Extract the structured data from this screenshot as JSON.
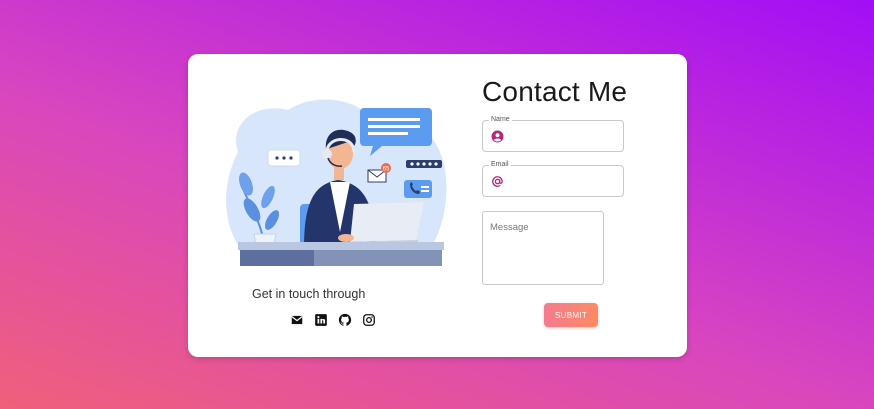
{
  "colors": {
    "accent": "#b5287a",
    "button_start": "#f47b8f",
    "button_end": "#fd8a62",
    "bg_start": "#f0607a",
    "bg_end": "#a20ef6"
  },
  "illustration": {
    "description_icon": "support-agent-illustration",
    "badge_count": "65"
  },
  "contact": {
    "tagline": "Get in touch through",
    "socials": [
      {
        "name": "email",
        "icon": "mail-icon"
      },
      {
        "name": "linkedin",
        "icon": "linkedin-icon"
      },
      {
        "name": "github",
        "icon": "github-icon"
      },
      {
        "name": "instagram",
        "icon": "instagram-icon"
      }
    ]
  },
  "form": {
    "title": "Contact Me",
    "name_label": "Name",
    "name_value": "",
    "name_icon": "user-circle-icon",
    "email_label": "Email",
    "email_value": "",
    "email_icon": "at-sign-icon",
    "message_placeholder": "Message",
    "submit_label": "SUBMIT"
  }
}
